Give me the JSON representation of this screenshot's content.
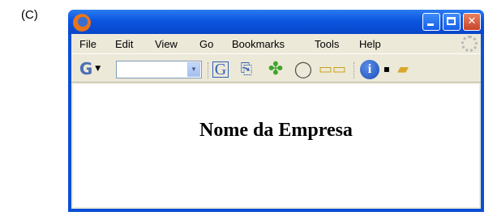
{
  "figure_label": "(C)",
  "menu": {
    "file": "File",
    "edit": "Edit",
    "view": "View",
    "go": "Go",
    "bookmarks": "Bookmarks",
    "tools": "Tools",
    "help": "Help"
  },
  "toolbar": {
    "search_engine_glyph": "G",
    "search_value": "",
    "icons": [
      "search-engine-icon",
      "google-icon",
      "page-icon",
      "clover-icon",
      "speech-bubble-icon",
      "book-icon",
      "info-icon",
      "folder-icon"
    ]
  },
  "content": {
    "company_name": "Nome da Empresa"
  },
  "colors": {
    "titlebar": "#0b55e0",
    "window_frame": "#0a4fd6",
    "chrome": "#ece9d8",
    "close_button": "#c9442a"
  }
}
